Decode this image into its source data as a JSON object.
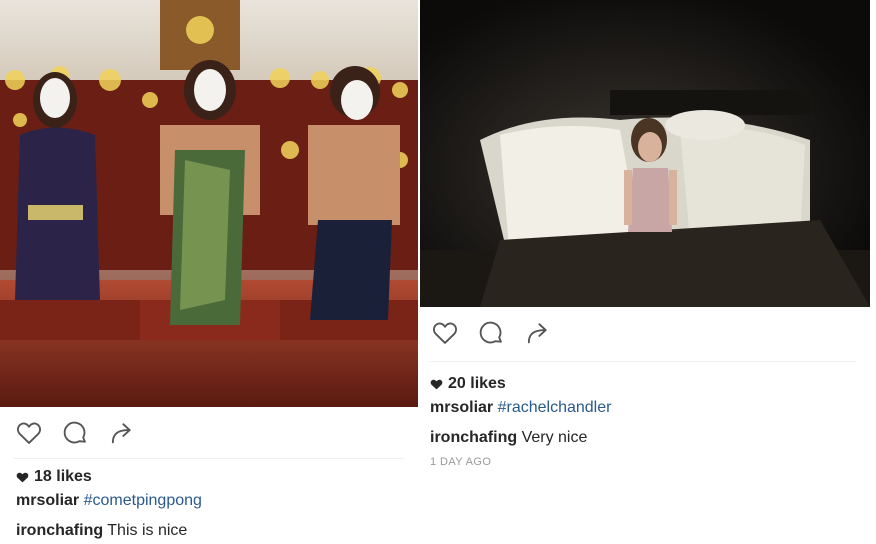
{
  "posts": [
    {
      "likes": "18 likes",
      "caption": {
        "username": "mrsoliar",
        "hashtag": "#cometpingpong"
      },
      "comment": {
        "username": "ironchafing",
        "text": "This is nice"
      }
    },
    {
      "likes": "20 likes",
      "caption": {
        "username": "mrsoliar",
        "hashtag": "#rachelchandler"
      },
      "comment": {
        "username": "ironchafing",
        "text": "Very nice"
      },
      "time": "1 DAY AGO"
    }
  ],
  "icons": [
    "heart-outline-icon",
    "comment-bubble-icon",
    "share-arrow-icon",
    "heart-filled-icon"
  ],
  "colors": {
    "hashtag": "#2a5a8c",
    "text": "#262626",
    "timestamp": "#999999"
  }
}
